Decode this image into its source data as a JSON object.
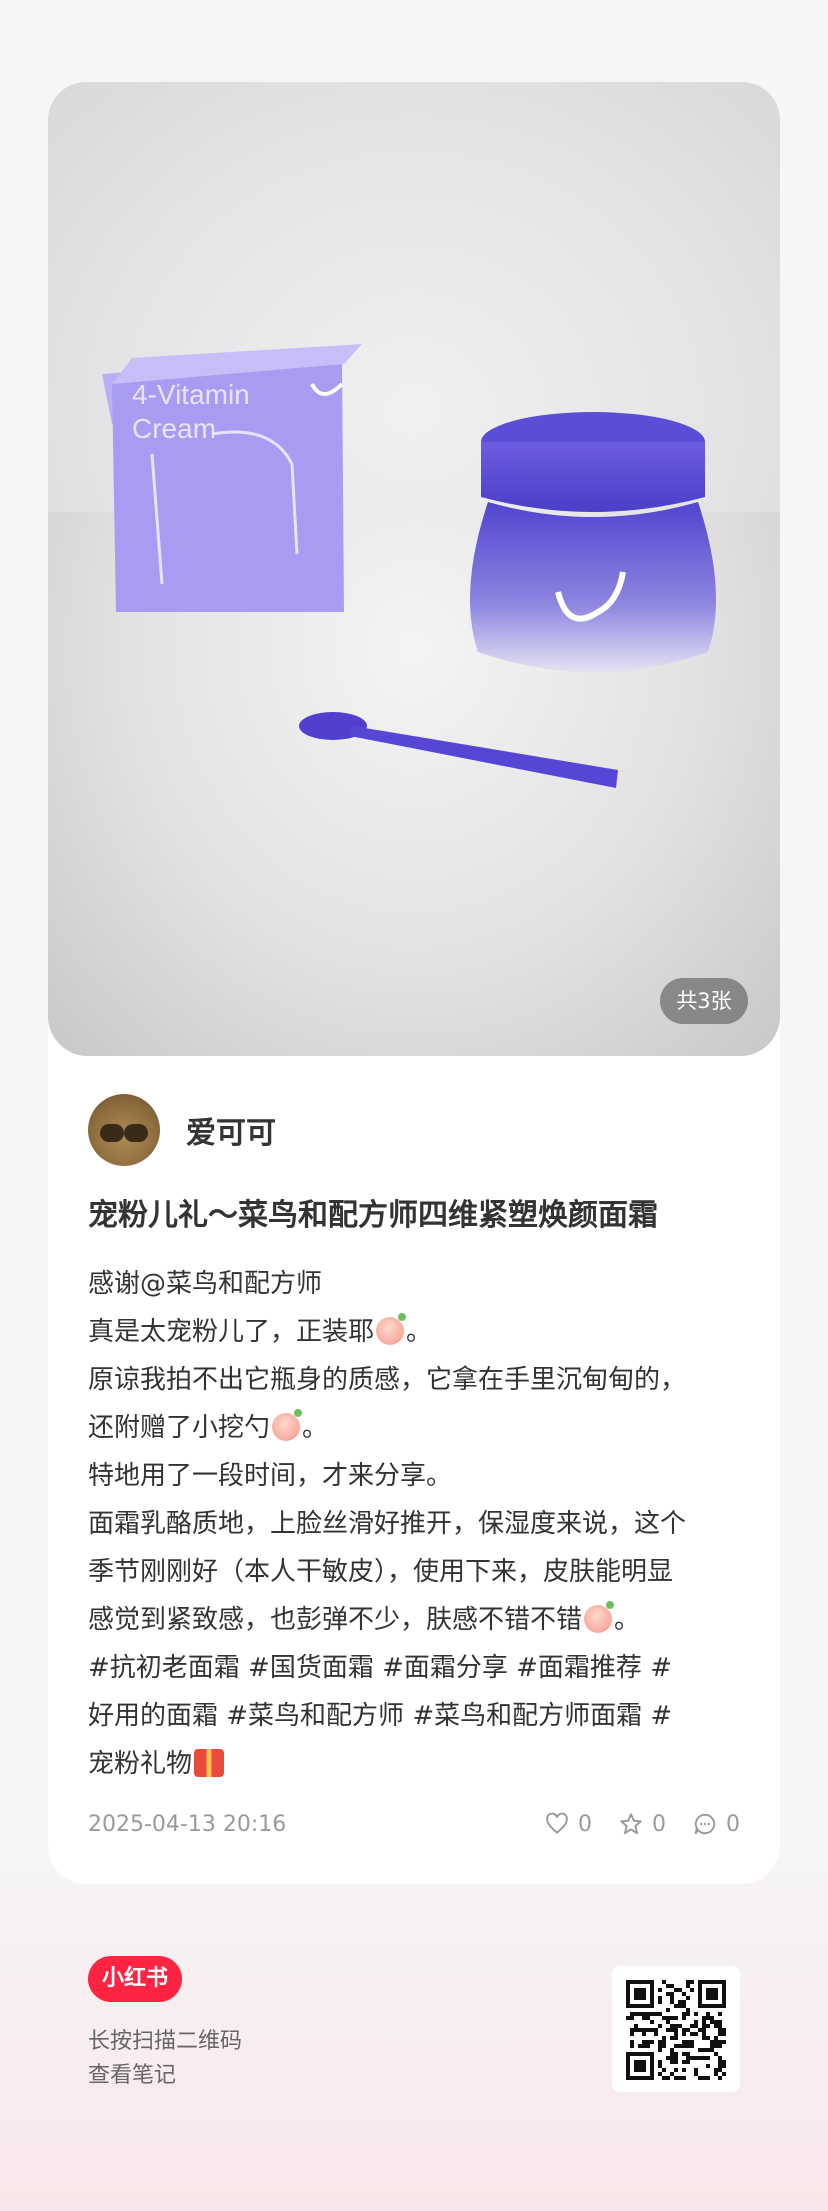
{
  "photo": {
    "count_label": "共3张",
    "product_box_text": [
      "4-Vitamin",
      "Cream"
    ]
  },
  "author": {
    "name": "爱可可"
  },
  "note": {
    "title": "宠粉儿礼～菜鸟和配方师四维紧塑焕颜面霜",
    "lines": [
      "感谢@菜鸟和配方师",
      "真是太宠粉儿了，正装耶",
      "。",
      "原谅我拍不出它瓶身的质感，它拿在手里沉甸甸的，",
      "还附赠了小挖勺",
      "。",
      "特地用了一段时间，才来分享。",
      "面霜乳酪质地，上脸丝滑好推开，保湿度来说，这个",
      "季节刚刚好（本人干敏皮），使用下来，皮肤能明显",
      "感觉到紧致感，也彭弹不少，肤感不错不错",
      "。",
      "#抗初老面霜  #国货面霜  #面霜分享  #面霜推荐  #",
      "好用的面霜  #菜鸟和配方师  #菜鸟和配方师面霜  #",
      "宠粉礼物"
    ],
    "date": "2025-04-13 20:16",
    "likes": "0",
    "collects": "0",
    "comments": "0"
  },
  "footer": {
    "brand": "小红书",
    "hint_line1": "长按扫描二维码",
    "hint_line2": "查看笔记"
  },
  "icons": {
    "like": "heart-icon",
    "collect": "star-icon",
    "comment": "comment-icon"
  },
  "colors": {
    "brand_red": "#ff2442",
    "product_purple": "#6a5ad8"
  }
}
